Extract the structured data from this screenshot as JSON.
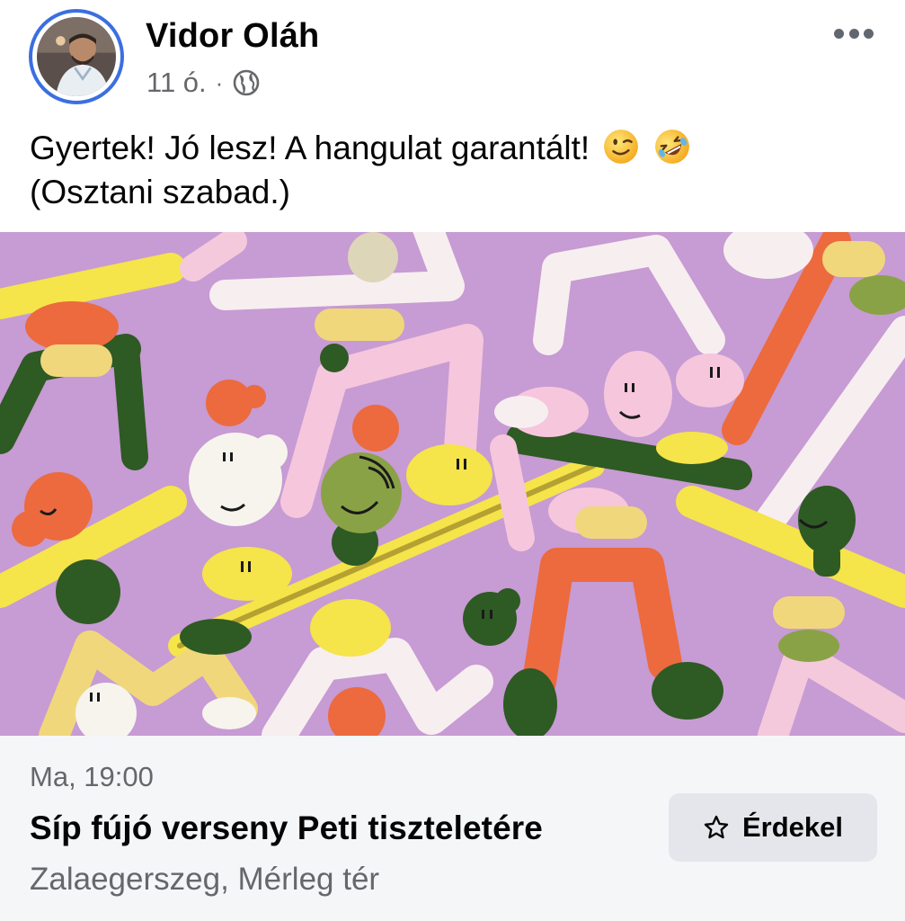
{
  "post": {
    "author_name": "Vidor Oláh",
    "time": "11 ó.",
    "separator": "·",
    "privacy_icon": "globe-icon",
    "more_icon": "more-options-icon",
    "text_line1": "Gyertek! Jó lesz! A hangulat garantált!",
    "text_line2": "(Osztani szabad.)",
    "emojis": [
      "winking-face-emoji",
      "rolling-on-floor-laughing-emoji"
    ]
  },
  "event": {
    "date": "Ma, 19:00",
    "title": "Síp fújó verseny Peti tiszteletére",
    "location": "Zalaegerszeg, Mérleg tér",
    "interested_label": "Érdekel",
    "interested_icon": "star-icon"
  },
  "colors": {
    "image_background": "#c79bd3",
    "avatar_ring": "#3b6fe0",
    "secondary_text": "#65676b",
    "card_background": "#f5f6f8",
    "button_background": "#e4e6eb"
  }
}
